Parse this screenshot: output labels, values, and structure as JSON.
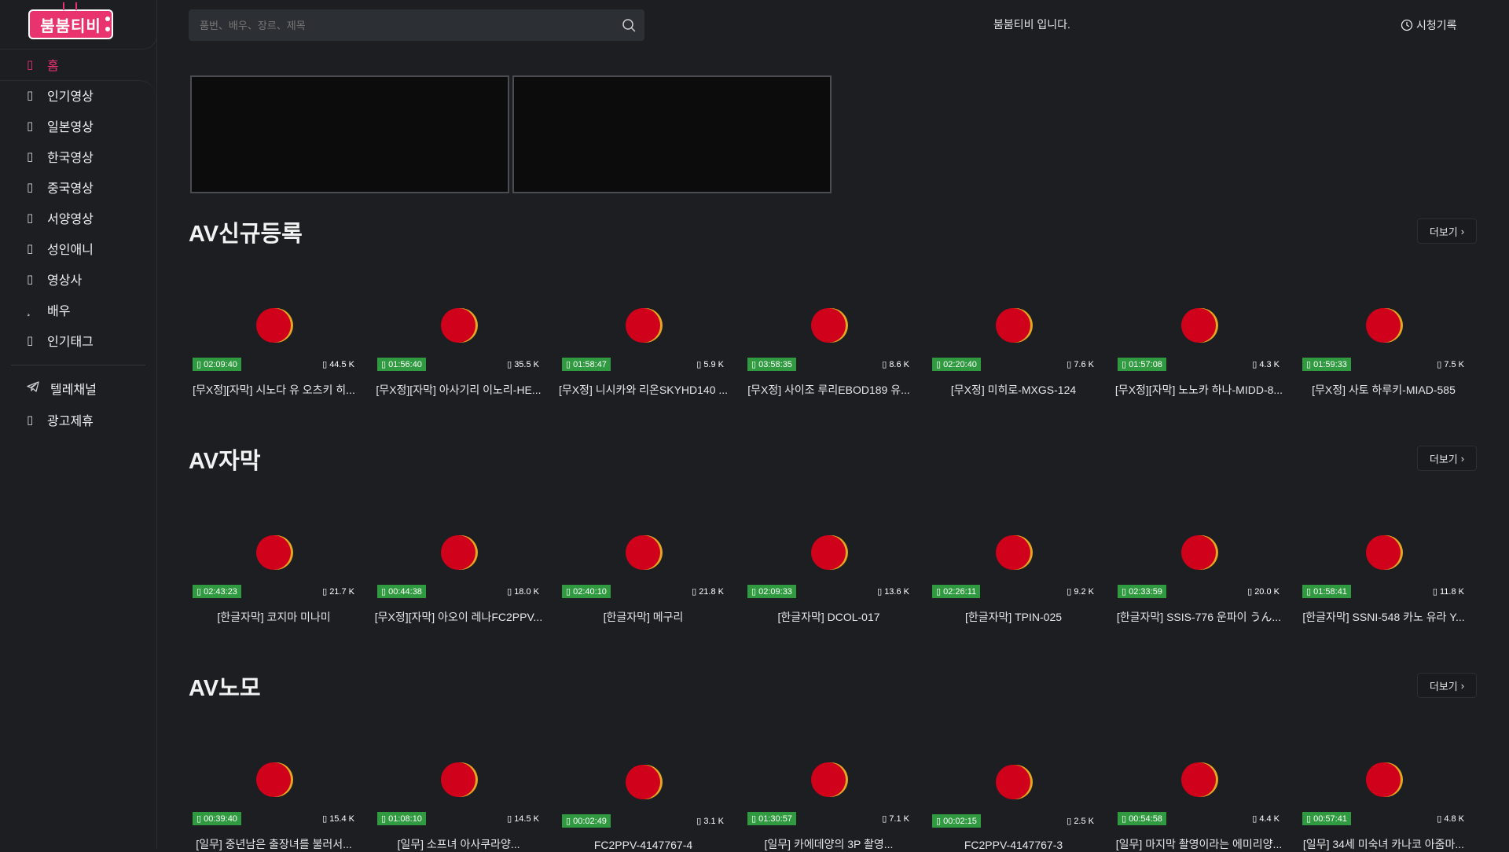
{
  "brand": {
    "logo_text": "붐붐티비"
  },
  "sidebar": {
    "items": [
      {
        "label": "홈",
        "icon": "home-icon",
        "active": true
      },
      {
        "label": "인기영상",
        "icon": "fire-icon"
      },
      {
        "label": "일본영상",
        "icon": "video-icon"
      },
      {
        "label": "한국영상",
        "icon": "video-icon"
      },
      {
        "label": "중국영상",
        "icon": "video-icon"
      },
      {
        "label": "서양영상",
        "icon": "video-icon"
      },
      {
        "label": "성인애니",
        "icon": "animation-icon"
      },
      {
        "label": "영상사",
        "icon": "studio-icon"
      },
      {
        "label": "배우",
        "icon": "actor-icon"
      },
      {
        "label": "인기태그",
        "icon": "tag-icon"
      }
    ],
    "extra": [
      {
        "label": "텔레채널",
        "icon": "telegram-icon"
      },
      {
        "label": "광고제휴",
        "icon": "ad-icon"
      }
    ]
  },
  "header": {
    "search_placeholder": "품번、배우、장르、제목",
    "notice": "붐붐티비 입니다.",
    "history_label": "시청기록"
  },
  "colors": {
    "accent": "#e8336f",
    "duration_badge": "#2f9a3f",
    "background": "#1c1e22"
  },
  "sections": [
    {
      "title": "AV신규등록",
      "more_label": "더보기",
      "cards": [
        {
          "duration": "02:09:40",
          "views": "44.5 K",
          "title": "[무X정][자막] 시노다 유 오츠키 히..."
        },
        {
          "duration": "01:56:40",
          "views": "35.5 K",
          "title": "[무X정][자막] 아사기리 이노리-HE..."
        },
        {
          "duration": "01:58:47",
          "views": "5.9 K",
          "title": "[무X정] 니시카와 리온SKYHD140 ..."
        },
        {
          "duration": "03:58:35",
          "views": "8.6 K",
          "title": "[무X정] 사이조 루리EBOD189 유..."
        },
        {
          "duration": "02:20:40",
          "views": "7.6 K",
          "title": "[무X정] 미히로-MXGS-124"
        },
        {
          "duration": "01:57:08",
          "views": "4.3 K",
          "title": "[무X정][자막] 노노카 하나-MIDD-8..."
        },
        {
          "duration": "01:59:33",
          "views": "7.5 K",
          "title": "[무X정] 사토 하루키-MIAD-585"
        }
      ]
    },
    {
      "title": "AV자막",
      "more_label": "더보기",
      "cards": [
        {
          "duration": "02:43:23",
          "views": "21.7 K",
          "title": "[한글자막] 코지마 미나미"
        },
        {
          "duration": "00:44:38",
          "views": "18.0 K",
          "title": "[무X정][자막] 아오이 레나FC2PPV..."
        },
        {
          "duration": "02:40:10",
          "views": "21.8 K",
          "title": "[한글자막] 메구리"
        },
        {
          "duration": "02:09:33",
          "views": "13.6 K",
          "title": "[한글자막] DCOL-017"
        },
        {
          "duration": "02:26:11",
          "views": "9.2 K",
          "title": "[한글자막] TPIN-025"
        },
        {
          "duration": "02:33:59",
          "views": "20.0 K",
          "title": "[한글자막] SSIS-776 운파이 うん..."
        },
        {
          "duration": "01:58:41",
          "views": "11.8 K",
          "title": "[한글자막] SSNI-548 카노 유라 Y..."
        }
      ]
    },
    {
      "title": "AV노모",
      "more_label": "더보기",
      "cards": [
        {
          "duration": "00:39:40",
          "views": "15.4 K",
          "title": "[일무] 중년남은 출장녀를 불러서..."
        },
        {
          "duration": "01:08:10",
          "views": "14.5 K",
          "title": "[일무] 소프녀 아사쿠라양..."
        },
        {
          "duration": "00:02:49",
          "views": "3.1 K",
          "title": "FC2PPV-4147767-4"
        },
        {
          "duration": "01:30:57",
          "views": "7.1 K",
          "title": "[일무] 카에데양의 3P 촬영..."
        },
        {
          "duration": "00:02:15",
          "views": "2.5 K",
          "title": "FC2PPV-4147767-3"
        },
        {
          "duration": "00:54:58",
          "views": "4.4 K",
          "title": "[일무] 마지막 촬영이라는 에미리양..."
        },
        {
          "duration": "00:57:41",
          "views": "4.8 K",
          "title": "[일무] 34세 미숙녀 카나코 아줌마..."
        }
      ]
    }
  ]
}
